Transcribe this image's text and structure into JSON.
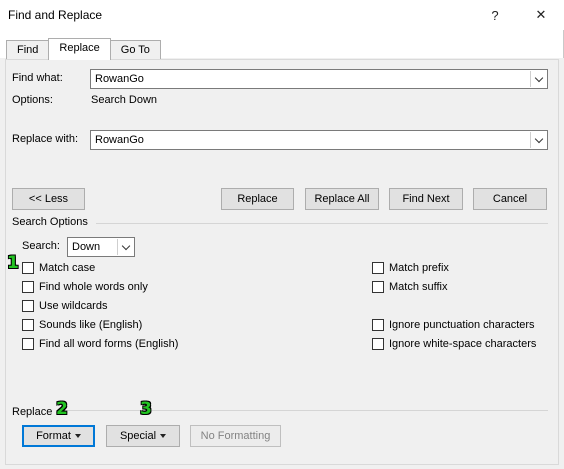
{
  "window": {
    "title": "Find and Replace",
    "help_glyph": "?",
    "close_glyph": "✕"
  },
  "tabs": [
    {
      "label": "Find",
      "active": false
    },
    {
      "label": "Replace",
      "active": true
    },
    {
      "label": "Go To",
      "active": false
    }
  ],
  "find": {
    "label": "Find what:",
    "value": "RowanGo",
    "options_label": "Options:",
    "options_value": "Search Down"
  },
  "replace": {
    "label": "Replace with:",
    "value": "RowanGo"
  },
  "buttons": {
    "less": "<< Less",
    "replace": "Replace",
    "replace_all": "Replace All",
    "find_next": "Find Next",
    "cancel": "Cancel"
  },
  "search_options": {
    "heading": "Search Options",
    "search_label": "Search:",
    "search_value": "Down",
    "left": [
      {
        "label": "Match case",
        "checked": false
      },
      {
        "label": "Find whole words only",
        "checked": false
      },
      {
        "label": "Use wildcards",
        "checked": false
      },
      {
        "label": "Sounds like (English)",
        "checked": false
      },
      {
        "label": "Find all word forms (English)",
        "checked": false
      }
    ],
    "right": [
      {
        "label": "Match prefix",
        "checked": false
      },
      {
        "label": "Match suffix",
        "checked": false
      },
      {
        "label": "Ignore punctuation characters",
        "checked": false
      },
      {
        "label": "Ignore white-space characters",
        "checked": false
      }
    ]
  },
  "replace_section": {
    "heading": "Replace",
    "format": "Format",
    "special": "Special",
    "no_formatting": "No Formatting"
  },
  "annotations": [
    "1",
    "2",
    "3"
  ],
  "colors": {
    "annotation": "#22c322",
    "focus": "#0078d7"
  }
}
